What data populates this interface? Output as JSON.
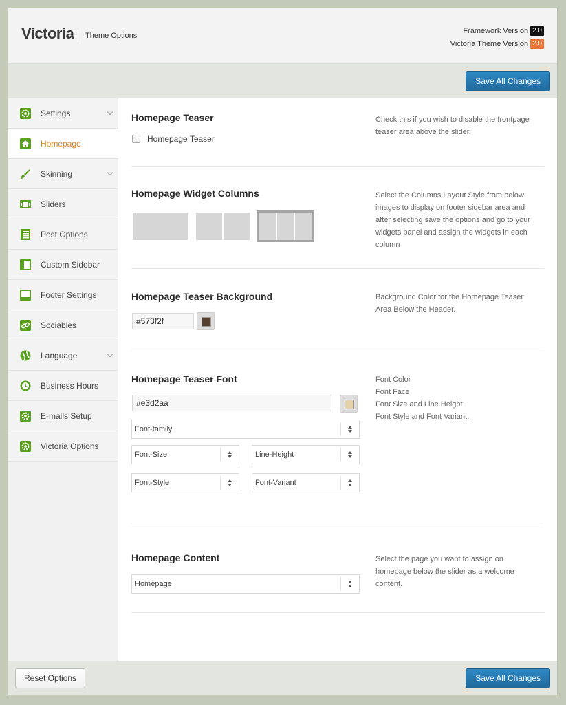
{
  "header": {
    "app_title": "Victoria",
    "subtitle": "Theme Options",
    "framework_version_label": "Framework Version",
    "framework_version": "2.0",
    "theme_version_label": "Victoria Theme Version",
    "theme_version": "2.0",
    "framework_badge_color": "#111111",
    "theme_badge_color": "#e8763a"
  },
  "toolbar": {
    "save_label": "Save All Changes"
  },
  "footer": {
    "reset_label": "Reset Options",
    "save_label": "Save All Changes"
  },
  "sidebar": {
    "items": [
      {
        "label": "Settings",
        "icon": "gear-icon",
        "has_submenu": true
      },
      {
        "label": "Homepage",
        "icon": "home-icon",
        "active": true
      },
      {
        "label": "Skinning",
        "icon": "brush-icon",
        "has_submenu": true
      },
      {
        "label": "Sliders",
        "icon": "sliders-icon"
      },
      {
        "label": "Post Options",
        "icon": "document-icon"
      },
      {
        "label": "Custom Sidebar",
        "icon": "sidebar-icon"
      },
      {
        "label": "Footer Settings",
        "icon": "footer-icon"
      },
      {
        "label": "Sociables",
        "icon": "link-icon"
      },
      {
        "label": "Language",
        "icon": "globe-icon",
        "has_submenu": true
      },
      {
        "label": "Business Hours",
        "icon": "clock-icon"
      },
      {
        "label": "E-mails Setup",
        "icon": "gear-icon"
      },
      {
        "label": "Victoria Options",
        "icon": "gear-icon"
      }
    ],
    "accent_color": "#e27f1d",
    "icon_color": "#5aa121"
  },
  "sections": {
    "teaser": {
      "title": "Homepage Teaser",
      "checkbox_label": "Homepage Teaser",
      "checked": false,
      "description": "Check this if you wish to disable the frontpage teaser area above the slider."
    },
    "widget_columns": {
      "title": "Homepage Widget Columns",
      "options": [
        "1 column",
        "2 columns",
        "3 columns"
      ],
      "selected": "3 columns",
      "description": "Select the Columns Layout Style from below images to display on footer sidebar area and after selecting save the options and go to your widgets panel and assign the widgets in each column"
    },
    "teaser_background": {
      "title": "Homepage Teaser Background",
      "value": "#573f2f",
      "description": "Background Color for the Homepage Teaser Area Below the Header."
    },
    "teaser_font": {
      "title": "Homepage Teaser Font",
      "color_value": "#e3d2aa",
      "font_family": "Font-family",
      "font_size": "Font-Size",
      "line_height": "Line-Height",
      "font_style": "Font-Style",
      "font_variant": "Font-Variant",
      "desc_lines": [
        "Font Color",
        "Font Face",
        "Font Size and Line Height",
        "Font Style and Font Variant."
      ]
    },
    "content": {
      "title": "Homepage Content",
      "selected_page": "Homepage",
      "description": "Select the page you want to assign on homepage below the slider as a welcome content."
    }
  }
}
